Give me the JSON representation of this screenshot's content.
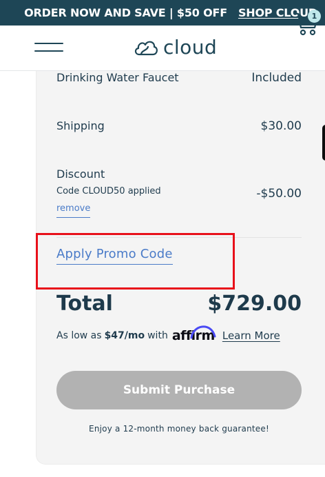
{
  "banner": {
    "offer_text": "ORDER NOW AND SAVE | $50 OFF",
    "shop_link": "SHOP CLOUD"
  },
  "header": {
    "logo_text": "cloud",
    "cart_count": "1"
  },
  "summary": {
    "faucet_label": "Drinking Water Faucet",
    "faucet_value": "Included",
    "shipping_label": "Shipping",
    "shipping_value": "$30.00",
    "discount_label": "Discount",
    "discount_code_text": "Code CLOUD50 applied",
    "remove_label": "remove",
    "discount_value": "-$50.00",
    "promo_link": "Apply Promo Code",
    "total_label": "Total",
    "total_value": "$729.00"
  },
  "financing": {
    "prefix": "As low as",
    "amount": "$47/mo",
    "with": "with",
    "brand": "affirm",
    "learn_more": "Learn More"
  },
  "actions": {
    "submit_label": "Submit Purchase",
    "guarantee_text": "Enjoy a 12-month money back guarantee!"
  },
  "colors": {
    "banner_bg": "#1e4656",
    "link_blue": "#4a7bc8",
    "highlight_red": "#e8101a",
    "button_disabled": "#b2b2b2"
  },
  "icons": [
    "menu-icon",
    "cloud-logo-icon",
    "cart-icon",
    "affirm-arc-icon"
  ]
}
